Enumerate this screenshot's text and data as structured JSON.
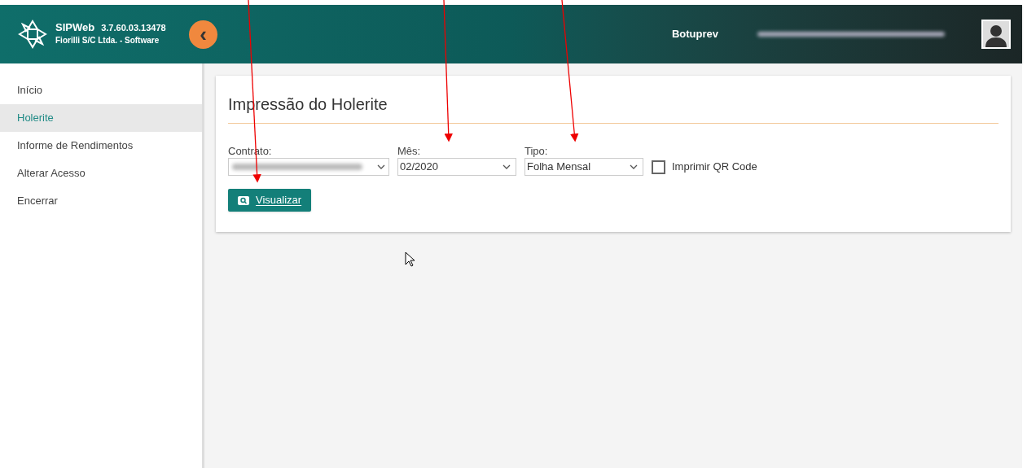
{
  "header": {
    "app_name": "SIPWeb",
    "version": "3.7.60.03.13478",
    "company": "Fiorilli S/C Ltda. - Software",
    "collapse_icon": "‹",
    "organization": "Botuprev"
  },
  "sidebar": {
    "items": [
      {
        "label": "Início",
        "selected": false
      },
      {
        "label": "Holerite",
        "selected": true
      },
      {
        "label": "Informe de Rendimentos",
        "selected": false
      },
      {
        "label": "Alterar Acesso",
        "selected": false
      },
      {
        "label": "Encerrar",
        "selected": false
      }
    ]
  },
  "card": {
    "title": "Impressão do Holerite",
    "fields": [
      {
        "label": "Contrato:",
        "kind": "blurred"
      },
      {
        "label": "Mês:",
        "kind": "select",
        "value": "02/2020"
      },
      {
        "label": "Tipo:",
        "kind": "select",
        "value": "Folha Mensal"
      }
    ],
    "qr_checkbox": {
      "label": "Imprimir QR Code",
      "checked": false
    },
    "button": {
      "label": "Visualizar"
    }
  }
}
